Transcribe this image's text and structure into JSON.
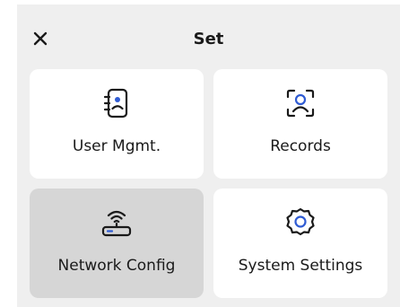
{
  "header": {
    "title": "Set",
    "close_icon": "close-icon"
  },
  "tiles": [
    {
      "label": "User Mgmt.",
      "icon": "contact-book-icon"
    },
    {
      "label": "Records",
      "icon": "face-scan-icon"
    },
    {
      "label": "Network Config",
      "icon": "wifi-router-icon",
      "selected": true
    },
    {
      "label": "System Settings",
      "icon": "gear-icon"
    }
  ],
  "colors": {
    "panel_bg": "#efefef",
    "tile_bg": "#ffffff",
    "tile_selected_bg": "#d6d6d6",
    "icon_color": "#1a1a1a",
    "accent": "#2f5bd3"
  }
}
